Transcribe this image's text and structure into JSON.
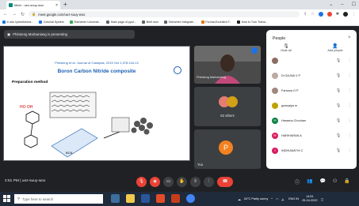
{
  "browser": {
    "tab_title": "Meet - uez-suuy-wox",
    "url": "meet.google.com/uez-suuy-wox",
    "bookmarks": [
      {
        "label": "In situ hydrotherma...",
        "color": "#1a73e8"
      },
      {
        "label": "Colonial System",
        "color": "#1a73e8"
      },
      {
        "label": "Shenzhen Universit...",
        "color": "#34a853"
      },
      {
        "label": "Main page of pycir...",
        "color": "#5f6368"
      },
      {
        "label": "Brief user",
        "color": "#5f6368"
      },
      {
        "label": "Shenzhen Integrate...",
        "color": "#5f6368"
      },
      {
        "label": "Format-Excellent F...",
        "color": "#e37400"
      },
      {
        "label": "How to Turn Transi...",
        "color": "#202124"
      }
    ]
  },
  "meet": {
    "presenting_text": "Phirsieng Marbaniang is presenting",
    "slide": {
      "citation": "Phirsieng et al. Journal of Catalysis, 2019 Oct 1;378:104-12",
      "title": "Boron Carbon Nitride composite",
      "subtitle": "Preparation method",
      "molecule_text": "HO OH",
      "product_label": "BCN"
    },
    "tiles": {
      "camera_name": "Phirsieng Marbaniang",
      "others_count": "62 others",
      "you_initial": "P",
      "you_label": "You"
    },
    "time_code": "2:51 PM | uez-suuy-wox"
  },
  "panel": {
    "title": "People",
    "mute_all": "Mute all",
    "add_people": "Add people",
    "participants": [
      {
        "name": "",
        "initial": "",
        "color": "#8d6e63"
      },
      {
        "name": "Dr.SAJNA V P",
        "initial": "",
        "color": "#bcaaa4"
      },
      {
        "name": "Farsana O P",
        "initial": "",
        "color": "#a1887f"
      },
      {
        "name": "gowsalya m",
        "initial": "",
        "color": "#c0a000"
      },
      {
        "name": "Haraana Chouhan",
        "initial": "H",
        "color": "#0b8043"
      },
      {
        "name": "HARIHARAN A",
        "initial": "H",
        "color": "#d81b60"
      },
      {
        "name": "INDHUMATHI C",
        "initial": "I",
        "color": "#d81b60"
      }
    ]
  },
  "taskbar": {
    "search_placeholder": "Type here to search",
    "weather": "34°C Partly sunny",
    "lang": "ENG IN",
    "time": "14:51",
    "date": "25-04-2022"
  }
}
